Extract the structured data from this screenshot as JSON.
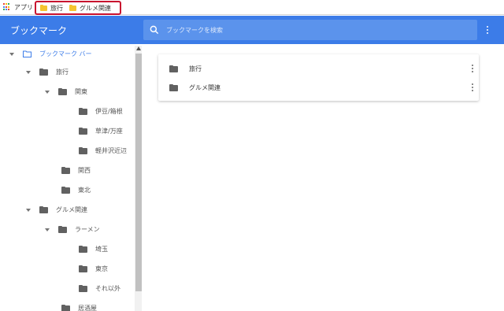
{
  "bookmarks_bar": {
    "apps_label": "アプリ",
    "items": [
      "旅行",
      "グルメ関連"
    ]
  },
  "header": {
    "title": "ブックマーク",
    "search_placeholder": "ブックマークを検索"
  },
  "sidebar": {
    "items": [
      {
        "label": "ブックマーク バー",
        "level": 0,
        "expanded": true,
        "selected": true
      },
      {
        "label": "旅行",
        "level": 1,
        "expanded": true
      },
      {
        "label": "関東",
        "level": 2,
        "expanded": true
      },
      {
        "label": "伊豆/箱根",
        "level": 3
      },
      {
        "label": "草津/万座",
        "level": 3
      },
      {
        "label": "軽井沢近辺",
        "level": 3
      },
      {
        "label": "関西",
        "level": 2
      },
      {
        "label": "東北",
        "level": 2
      },
      {
        "label": "グルメ関連",
        "level": 1,
        "expanded": true
      },
      {
        "label": "ラーメン",
        "level": 2,
        "expanded": true
      },
      {
        "label": "埼玉",
        "level": 3
      },
      {
        "label": "東京",
        "level": 3
      },
      {
        "label": "それ以外",
        "level": 3
      },
      {
        "label": "居酒屋",
        "level": 2
      }
    ]
  },
  "main": {
    "items": [
      "旅行",
      "グルメ関連"
    ]
  },
  "colors": {
    "accent": "#3c7ce8",
    "highlight_border": "#c8102e",
    "folder_yellow": "#f4c430",
    "folder_gray": "#616161"
  }
}
